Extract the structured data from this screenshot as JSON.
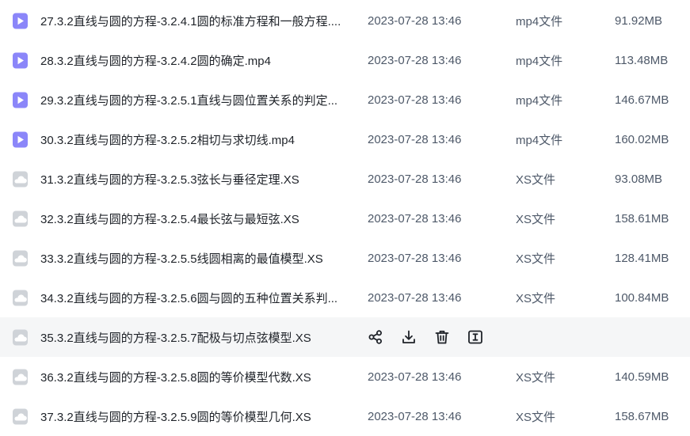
{
  "colors": {
    "video_icon": "#8b86f9",
    "doc_icon": "#cfd3d8",
    "hover_row": "#f5f6f7",
    "action_icon": "#1f2329"
  },
  "files": [
    {
      "name": "27.3.2直线与圆的方程-3.2.4.1圆的标准方程和一般方程....",
      "date": "2023-07-28 13:46",
      "type": "mp4文件",
      "size": "91.92MB",
      "icon": "video-file-icon"
    },
    {
      "name": "28.3.2直线与圆的方程-3.2.4.2圆的确定.mp4",
      "date": "2023-07-28 13:46",
      "type": "mp4文件",
      "size": "113.48MB",
      "icon": "video-file-icon"
    },
    {
      "name": "29.3.2直线与圆的方程-3.2.5.1直线与圆位置关系的判定...",
      "date": "2023-07-28 13:46",
      "type": "mp4文件",
      "size": "146.67MB",
      "icon": "video-file-icon"
    },
    {
      "name": "30.3.2直线与圆的方程-3.2.5.2相切与求切线.mp4",
      "date": "2023-07-28 13:46",
      "type": "mp4文件",
      "size": "160.02MB",
      "icon": "video-file-icon"
    },
    {
      "name": "31.3.2直线与圆的方程-3.2.5.3弦长与垂径定理.XS",
      "date": "2023-07-28 13:46",
      "type": "XS文件",
      "size": "93.08MB",
      "icon": "cloud-file-icon"
    },
    {
      "name": "32.3.2直线与圆的方程-3.2.5.4最长弦与最短弦.XS",
      "date": "2023-07-28 13:46",
      "type": "XS文件",
      "size": "158.61MB",
      "icon": "cloud-file-icon"
    },
    {
      "name": "33.3.2直线与圆的方程-3.2.5.5线圆相离的最值模型.XS",
      "date": "2023-07-28 13:46",
      "type": "XS文件",
      "size": "128.41MB",
      "icon": "cloud-file-icon"
    },
    {
      "name": "34.3.2直线与圆的方程-3.2.5.6圆与圆的五种位置关系判...",
      "date": "2023-07-28 13:46",
      "type": "XS文件",
      "size": "100.84MB",
      "icon": "cloud-file-icon"
    },
    {
      "name": "35.3.2直线与圆的方程-3.2.5.7配极与切点弦模型.XS",
      "date": "",
      "type": "",
      "size": "",
      "icon": "cloud-file-icon",
      "hovered": true
    },
    {
      "name": "36.3.2直线与圆的方程-3.2.5.8圆的等价模型代数.XS",
      "date": "2023-07-28 13:46",
      "type": "XS文件",
      "size": "140.59MB",
      "icon": "cloud-file-icon"
    },
    {
      "name": "37.3.2直线与圆的方程-3.2.5.9圆的等价模型几何.XS",
      "date": "2023-07-28 13:46",
      "type": "XS文件",
      "size": "158.67MB",
      "icon": "cloud-file-icon"
    }
  ],
  "hover_actions": [
    "share-icon",
    "download-icon",
    "delete-icon",
    "rename-icon"
  ]
}
